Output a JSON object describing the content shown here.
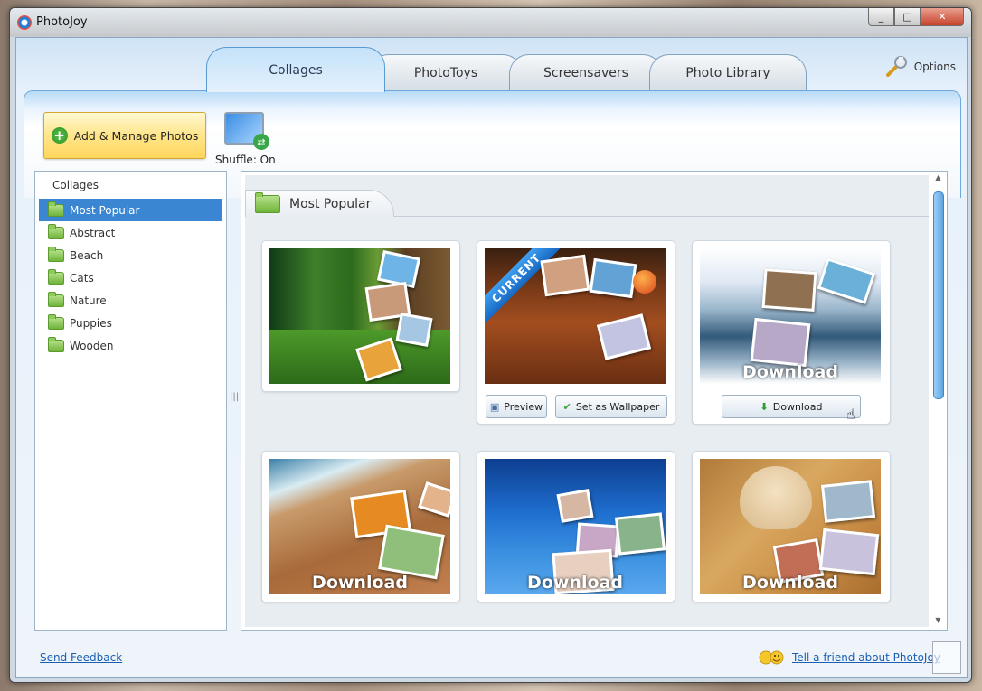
{
  "window": {
    "title": "PhotoJoy",
    "buttons": {
      "minimize": "_",
      "maximize": "□",
      "close": "✕"
    }
  },
  "tabs": [
    {
      "label": "Collages",
      "active": true
    },
    {
      "label": "PhotoToys",
      "active": false
    },
    {
      "label": "Screensavers",
      "active": false
    },
    {
      "label": "Photo Library",
      "active": false
    }
  ],
  "options": {
    "label": "Options",
    "icon": "wrench-icon"
  },
  "toolbar": {
    "add_manage_label": "Add & Manage Photos",
    "shuffle_label": "Shuffle: On"
  },
  "sidebar": {
    "header": "Collages",
    "items": [
      {
        "label": "Most Popular",
        "selected": true
      },
      {
        "label": "Abstract"
      },
      {
        "label": "Beach"
      },
      {
        "label": "Cats"
      },
      {
        "label": "Nature"
      },
      {
        "label": "Puppies"
      },
      {
        "label": "Wooden"
      }
    ]
  },
  "content": {
    "section_title": "Most Popular",
    "cards": [
      {
        "name": "forest",
        "overlay": ""
      },
      {
        "name": "wooden",
        "ribbon": "CURRENT",
        "preview": "Preview",
        "set_wallpaper": "Set as Wallpaper"
      },
      {
        "name": "snow",
        "overlay": "Download",
        "download": "Download"
      },
      {
        "name": "beach",
        "overlay": "Download"
      },
      {
        "name": "underwater",
        "overlay": "Download"
      },
      {
        "name": "puppy",
        "overlay": "Download"
      }
    ]
  },
  "footer": {
    "feedback": "Send Feedback",
    "tell_friend": "Tell a friend about PhotoJoy"
  },
  "colors": {
    "accent": "#3a86d3",
    "tab_border": "#5a9ad2",
    "button_yellow": "#ffd65c",
    "link": "#1a5fb4"
  }
}
